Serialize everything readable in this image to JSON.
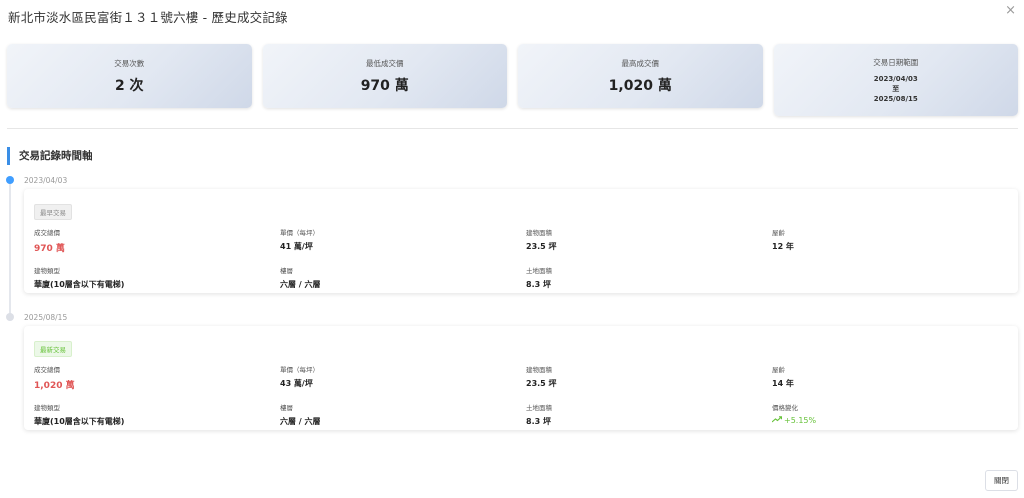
{
  "dialog": {
    "title": "新北市淡水區民富街１３１號六樓 - 歷史成交記錄",
    "close_icon": "×",
    "close_button_label": "關閉"
  },
  "stats": {
    "count": {
      "label": "交易次數",
      "value": "2 次"
    },
    "min_price": {
      "label": "最低成交價",
      "value": "970 萬"
    },
    "max_price": {
      "label": "最高成交價",
      "value": "1,020 萬"
    },
    "date_range": {
      "label": "交易日期範圍",
      "start": "2023/04/03",
      "separator": "至",
      "end": "2025/08/15"
    }
  },
  "timeline": {
    "section_title": "交易記錄時間軸",
    "records": [
      {
        "date": "2023/04/03",
        "tag": "最早交易",
        "total_price_label": "成交總價",
        "total_price": "970 萬",
        "unit_price_label": "單價（每坪）",
        "unit_price": "41 萬/坪",
        "building_area_label": "建物面積",
        "building_area": "23.5 坪",
        "age_label": "屋齡",
        "age": "12 年",
        "type_label": "建物類型",
        "type": "華廈(10層含以下有電梯)",
        "floor_label": "樓層",
        "floor": "六層 / 六層",
        "land_area_label": "土地面積",
        "land_area": "8.3 坪"
      },
      {
        "date": "2025/08/15",
        "tag": "最新交易",
        "total_price_label": "成交總價",
        "total_price": "1,020 萬",
        "unit_price_label": "單價（每坪）",
        "unit_price": "43 萬/坪",
        "building_area_label": "建物面積",
        "building_area": "23.5 坪",
        "age_label": "屋齡",
        "age": "14 年",
        "type_label": "建物類型",
        "type": "華廈(10層含以下有電梯)",
        "floor_label": "樓層",
        "floor": "六層 / 六層",
        "land_area_label": "土地面積",
        "land_area": "8.3 坪",
        "change_label": "價格變化",
        "change": "+5.15%"
      }
    ]
  },
  "colors": {
    "accent": "#409eff",
    "price_red": "#e05555",
    "up_green": "#67c23a"
  },
  "icons": {
    "close": "close-icon",
    "trend": "trend-up-icon"
  }
}
